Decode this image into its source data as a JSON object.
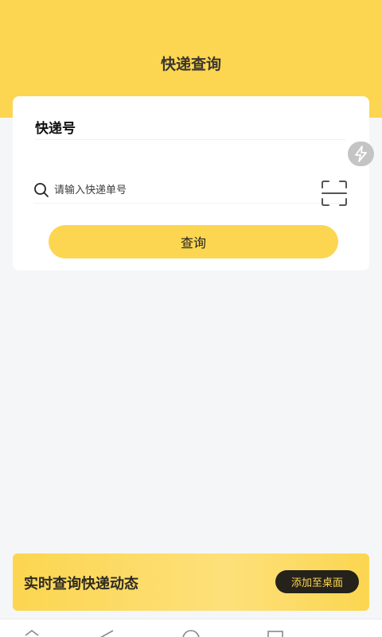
{
  "header": {
    "title": "快递查询",
    "background": "#fcd650"
  },
  "form": {
    "section_title": "快递号",
    "search_placeholder": "请输入快递单号",
    "search_value": "",
    "query_label": "查询"
  },
  "banner": {
    "text": "实时查询快递动态",
    "button_label": "添加至桌面"
  },
  "icons": {
    "search": "search-icon",
    "scan": "scan-icon",
    "floating": "lightning-icon",
    "nav": [
      "menu-icon",
      "back-icon",
      "home-icon",
      "recents-icon"
    ]
  },
  "colors": {
    "accent": "#fcd650",
    "dark_button": "#25211b",
    "page_background": "#f5f6f8"
  }
}
